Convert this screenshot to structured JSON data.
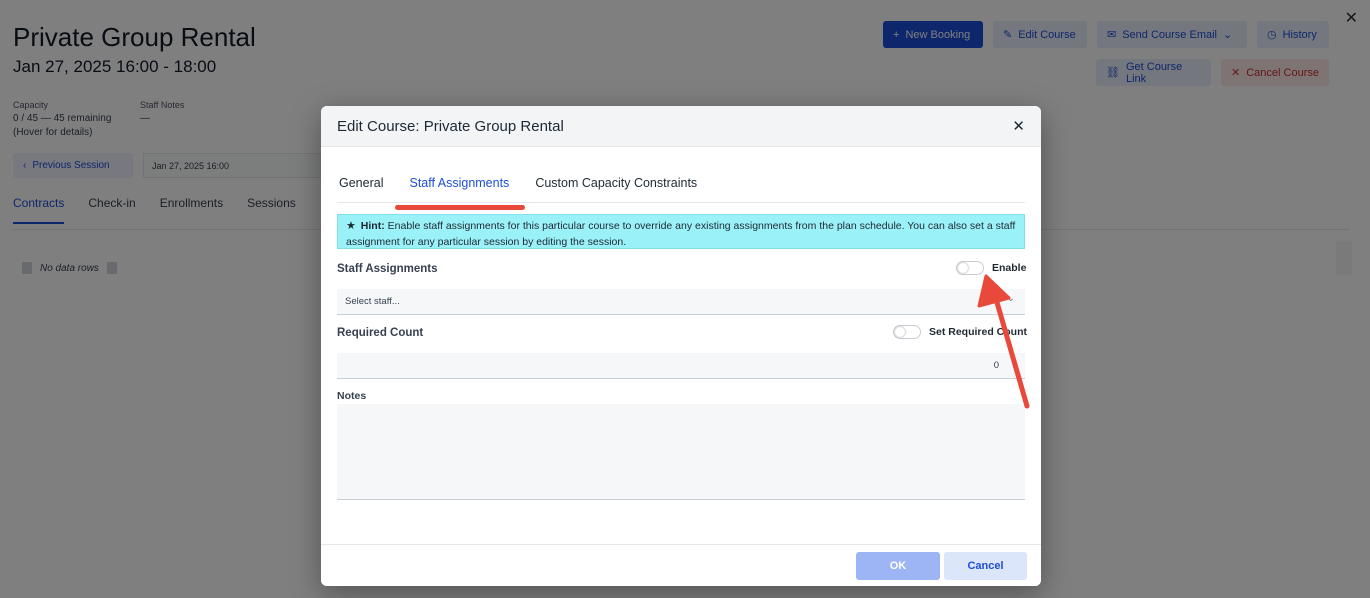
{
  "page": {
    "title": "Private Group Rental",
    "subtitle": "Jan 27, 2025 16:00 - 18:00",
    "capacity_label": "Capacity",
    "capacity_value": "0 / 45 — 45 remaining",
    "capacity_hint": "(Hover for details)",
    "staff_notes_label": "Staff Notes",
    "staff_notes_value": "—",
    "toolbar": {
      "new_booking": "New Booking",
      "edit_course": "Edit Course",
      "send_email": "Send Course Email",
      "history": "History",
      "get_link": "Get Course Link",
      "cancel_course": "Cancel Course"
    },
    "previous_session": "Previous Session",
    "session_value": "Jan 27, 2025 16:00",
    "tabs": [
      "Contracts",
      "Check-in",
      "Enrollments",
      "Sessions"
    ],
    "no_data": "No data rows"
  },
  "modal": {
    "title": "Edit Course: Private Group Rental",
    "tabs": [
      "General",
      "Staff Assignments",
      "Custom Capacity Constraints"
    ],
    "active_tab": "Staff Assignments",
    "hint_label": "Hint:",
    "hint_text": "Enable staff assignments for this particular course to override any existing assignments from the plan schedule. You can also set a staff assignment for any particular session by editing the session.",
    "staff_assignments_label": "Staff Assignments",
    "enable_label": "Enable",
    "enable_on": false,
    "staff_placeholder": "Select staff...",
    "required_count_label": "Required Count",
    "set_required_count_label": "Set Required Count",
    "set_required_count_on": false,
    "required_count_value": "0",
    "notes_label": "Notes",
    "notes_value": "",
    "ok_label": "OK",
    "cancel_label": "Cancel"
  },
  "colors": {
    "accent": "#1d4ed8",
    "hint_bg": "#9af1f7",
    "annotation": "#e8493b",
    "overlay": "rgba(0,0,0,0.5)"
  }
}
